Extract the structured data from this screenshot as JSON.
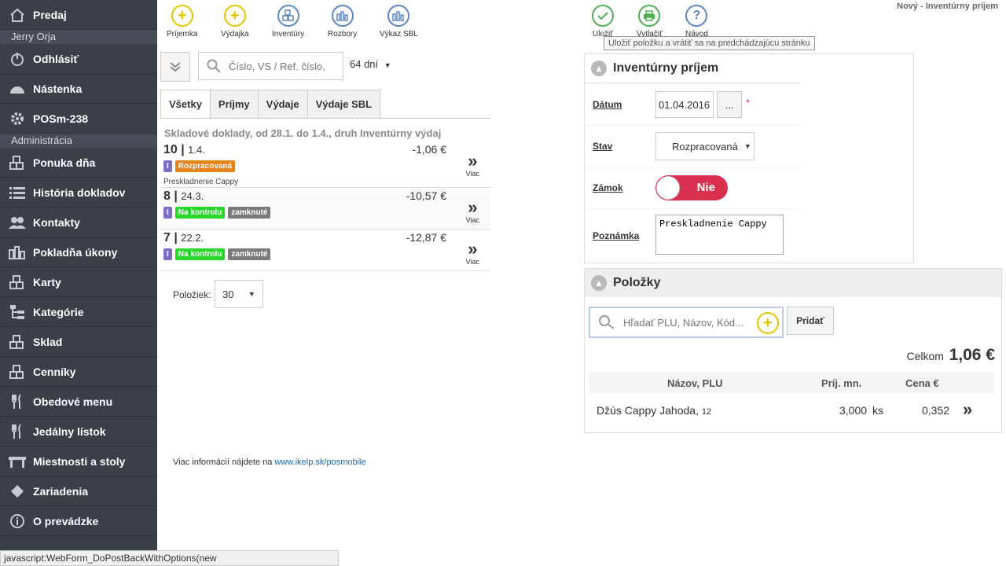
{
  "sidebar": {
    "items": [
      {
        "label": "Predaj",
        "icon": "home-icon"
      },
      {
        "section": "Jerry Orja"
      },
      {
        "label": "Odhlásiť",
        "icon": "power-icon"
      },
      {
        "label": "Nástenka",
        "icon": "dashboard-icon"
      },
      {
        "label": "POSm-238",
        "icon": "gear-icon"
      },
      {
        "section": "Administrácia"
      },
      {
        "label": "Ponuka dňa",
        "icon": "boxes-star-icon"
      },
      {
        "label": "História dokladov",
        "icon": "list-icon"
      },
      {
        "label": "Kontakty",
        "icon": "users-icon"
      },
      {
        "label": "Pokladňa úkony",
        "icon": "bars-icon"
      },
      {
        "label": "Karty",
        "icon": "boxes-icon"
      },
      {
        "label": "Kategórie",
        "icon": "tree-icon"
      },
      {
        "label": "Sklad",
        "icon": "boxes-icon"
      },
      {
        "label": "Cenníky",
        "icon": "boxes-icon"
      },
      {
        "label": "Obedové menu",
        "icon": "cutlery-icon"
      },
      {
        "label": "Jedálny lístok",
        "icon": "cutlery-icon"
      },
      {
        "label": "Miestnosti a stoly",
        "icon": "table-icon"
      },
      {
        "label": "Zariadenia",
        "icon": "diamond-icon"
      },
      {
        "label": "O prevádzke",
        "icon": "info-icon"
      }
    ]
  },
  "toolbar": {
    "left": [
      {
        "label": "Príjemka",
        "icon": "plus-icon"
      },
      {
        "label": "Výdajka",
        "icon": "plus-icon"
      },
      {
        "label": "Inventúry",
        "icon": "boxes-icon"
      },
      {
        "label": "Rozbory",
        "icon": "bars-icon"
      },
      {
        "label": "Výkaz SBL",
        "icon": "bars-icon"
      }
    ],
    "right": [
      {
        "label": "Uložiť",
        "icon": "check-icon"
      },
      {
        "label": "Vytlačiť",
        "icon": "print-icon"
      },
      {
        "label": "Návod",
        "icon": "help-icon",
        "glyph": "?"
      }
    ],
    "tooltip": "Uložiť položku a vrátiť sa na predchádzajúcu stránku"
  },
  "page_title": "Nový - Inventúrny príjem",
  "list": {
    "search_placeholder": "Číslo, VS / Ref. číslo,",
    "days": "64 dní",
    "tabs": [
      "Všetky",
      "Príjmy",
      "Výdaje",
      "Výdaje SBL"
    ],
    "heading": "Skladové doklady, od 28.1. do 1.4., druh Inventúrny výdaj",
    "rows": [
      {
        "num": "10",
        "date": "1.4.",
        "amount": "-1,06 €",
        "type": "I",
        "status": "Rozpracovaná",
        "status_color": "#e8821a",
        "locked": "",
        "note": "Preskladnenie Cappy"
      },
      {
        "num": "8",
        "date": "24.3.",
        "amount": "-10,57 €",
        "type": "I",
        "status": "Na kontrolu",
        "status_color": "#27d82b",
        "locked": "zamknuté",
        "note": ""
      },
      {
        "num": "7",
        "date": "22.2.",
        "amount": "-12,87 €",
        "type": "I",
        "status": "Na kontrolu",
        "status_color": "#27d82b",
        "locked": "zamknuté",
        "note": ""
      }
    ],
    "more_label": "Viac",
    "per_page_label": "Položiek:",
    "per_page_value": "30"
  },
  "footer": {
    "text": "Viac informácií nájdete na ",
    "link": "www.ikelp.sk/posmobile"
  },
  "status_bar": "javascript:WebForm_DoPostBackWithOptions(new WebForm_PostBackOptions(...",
  "form": {
    "title": "Inventúrny príjem",
    "date_label": "Dátum",
    "date_value": "01.04.2016",
    "date_btn": "...",
    "required_mark": "*",
    "state_label": "Stav",
    "state_value": "Rozpracovaná",
    "lock_label": "Zámok",
    "lock_value": "Nie",
    "note_label": "Poznámka",
    "note_value": "Preskladnenie Cappy"
  },
  "items": {
    "title": "Položky",
    "search_placeholder": "Hľadať PLU, Názov, Kód...",
    "add_label": "Pridať",
    "total_label": "Celkom",
    "total_value": "1,06 €",
    "columns": [
      "Názov, PLU",
      "Príj. mn.",
      "Cena €"
    ],
    "rows": [
      {
        "name": "Džús Cappy Jahoda,",
        "plu": "12",
        "qty": "3,000",
        "unit": "ks",
        "price": "0,352"
      }
    ]
  }
}
